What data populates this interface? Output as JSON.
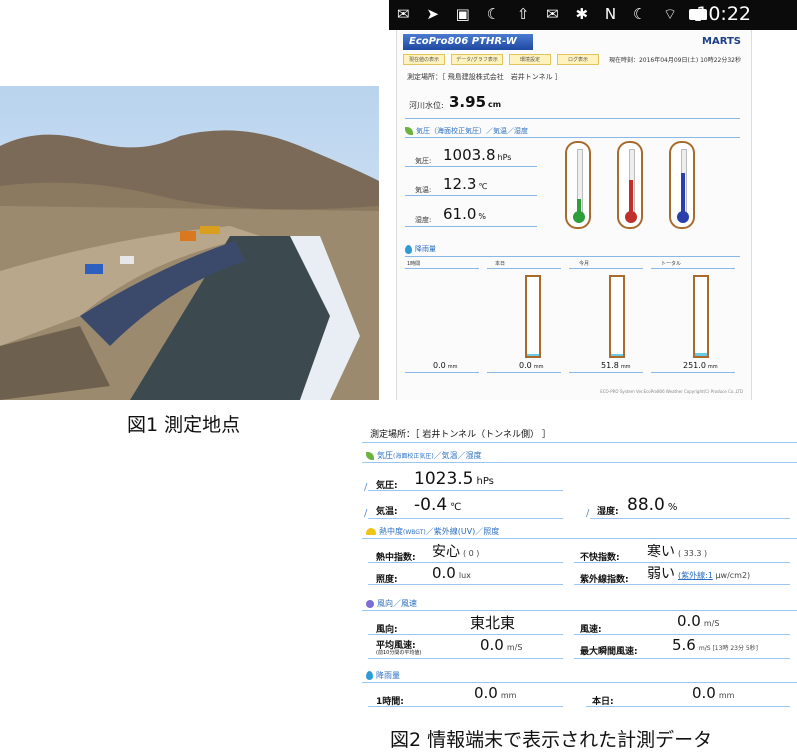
{
  "figure1": {
    "caption": "図1 測定地点"
  },
  "figure2": {
    "caption": "図2 情報端末で表示された計測データ"
  },
  "status_bar": {
    "time": "10:22",
    "icons": [
      "message-icon",
      "send-icon",
      "image-icon",
      "moon-icon",
      "upload-icon",
      "mail-icon",
      "bluetooth-icon",
      "nfc-icon",
      "moon-icon",
      "wifi-icon",
      "signal-icon",
      "battery-icon"
    ]
  },
  "tablet": {
    "app_title": "EcoPro806 PTHR-W",
    "brand": "MARTS",
    "tabs": [
      "現在値の表示",
      "データ/グラフ表示",
      "環境設定",
      "ログ表示"
    ],
    "current_time": "現在時刻：2016年04月09日(土) 10時22分32秒",
    "location": "測定場所：［ 飛島建設株式会社　岩井トンネル ］",
    "river_label": "河川水位:",
    "river_value": "3.95",
    "river_unit": "cm",
    "section_weather": "気圧（海面校正気圧）／気温／湿度",
    "pressure_label": "気圧:",
    "pressure_value": "1003.8",
    "pressure_unit": "hPs",
    "temp_label": "気温:",
    "temp_value": "12.3",
    "temp_unit": "℃",
    "humidity_label": "湿度:",
    "humidity_value": "61.0",
    "humidity_unit": "%",
    "thermometers": [
      {
        "name": "green",
        "color": "#2e9e3a",
        "level": 0.25
      },
      {
        "name": "red",
        "color": "#c0302b",
        "level": 0.55
      },
      {
        "name": "blue",
        "color": "#2b3fa8",
        "level": 0.65
      }
    ],
    "section_rain": "降雨量",
    "rain_cols": [
      {
        "label": "1時間",
        "value": "0.0",
        "unit": "mm",
        "level": 0
      },
      {
        "label": "本日",
        "value": "0.0",
        "unit": "mm",
        "level": 0.01
      },
      {
        "label": "今月",
        "value": "51.8",
        "unit": "mm",
        "level": 0.03
      },
      {
        "label": "トータル",
        "value": "251.0",
        "unit": "mm",
        "level": 0.04
      }
    ],
    "footer": "ECO-PRO System Ver.EcoPro806 Weather Copyright(C) Produce Co.,LTD"
  },
  "phone": {
    "location": "測定場所：［ 岩井トンネル（トンネル側） ］",
    "section_weather": "気圧",
    "section_weather_note": "(海面校正気圧)",
    "section_weather_rest": "／気温／湿度",
    "pressure_label": "気圧:",
    "pressure_value": "1023.5",
    "pressure_unit": "hPs",
    "temp_label": "気温:",
    "temp_value": "-0.4",
    "temp_unit": "℃",
    "humidity_label": "湿度:",
    "humidity_value": "88.0",
    "humidity_unit": "%",
    "section_heat": "熱中度",
    "section_heat_note": "(WBGT)",
    "section_heat_rest": "／紫外線(UV)／照度",
    "heat_label": "熱中指数:",
    "heat_value": "安心",
    "heat_sub": "( 0 )",
    "discomfort_label": "不快指数:",
    "discomfort_value": "寒い",
    "discomfort_sub": "( 33.3 )",
    "lux_label": "照度:",
    "lux_value": "0.0",
    "lux_unit": "lux",
    "uv_label": "紫外線指数:",
    "uv_value": "弱い",
    "uv_sub_link": "(紫外線:1",
    "uv_sub_rest": " μw/cm2)",
    "section_wind": "風向／風速",
    "wind_dir_label": "風向:",
    "wind_dir_value": "東北東",
    "wind_speed_label": "風速:",
    "wind_speed_value": "0.0",
    "wind_speed_unit": "m/S",
    "avg_wind_label": "平均風速:",
    "avg_wind_sub": "(前10分間の平均値)",
    "avg_wind_value": "0.0",
    "avg_wind_unit": "m/S",
    "max_wind_label": "最大瞬間風速:",
    "max_wind_value": "5.6",
    "max_wind_unit": "m/S [13時 23分 5秒]",
    "section_rain": "降雨量",
    "rain_hour_label": "1時間:",
    "rain_hour_value": "0.0",
    "rain_hour_unit": "mm",
    "rain_day_label": "本日:",
    "rain_day_value": "0.0",
    "rain_day_unit": "mm"
  }
}
